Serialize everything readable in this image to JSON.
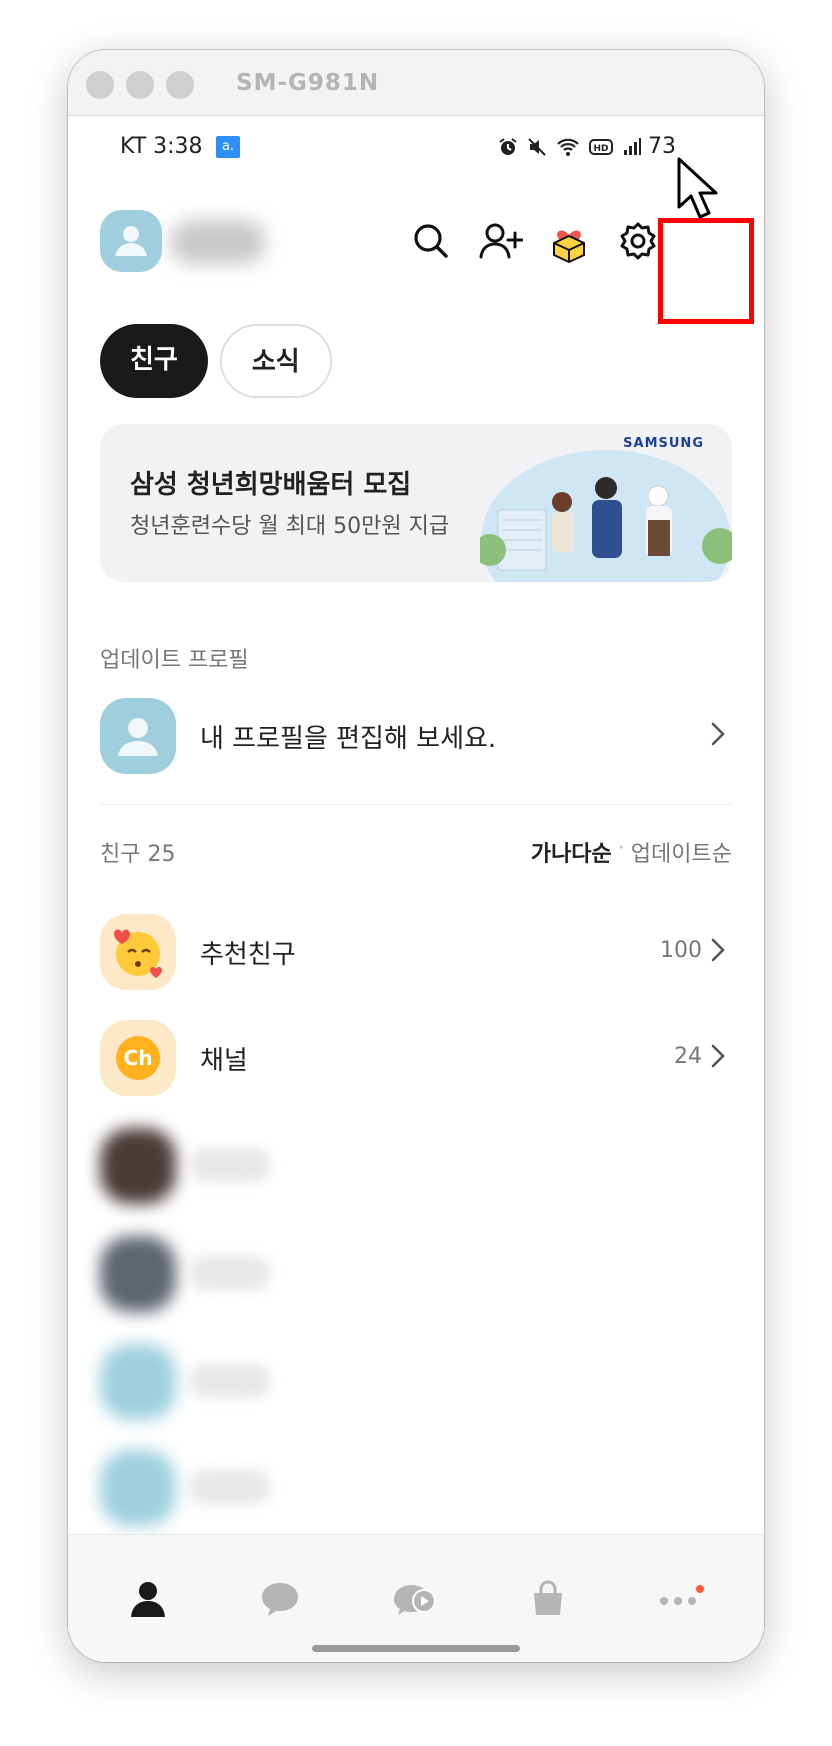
{
  "window": {
    "title": "SM-G981N"
  },
  "statusbar": {
    "carrier_time": "KT 3:38",
    "badge": "a.",
    "battery": "73"
  },
  "tabs": {
    "friends": "친구",
    "news": "소식"
  },
  "banner": {
    "brand": "SAMSUNG",
    "title": "삼성 청년희망배움터 모집",
    "subtitle": "청년훈련수당 월 최대 50만원 지급"
  },
  "update_section": {
    "label": "업데이트 프로필",
    "profile_prompt": "내 프로필을 편집해 보세요."
  },
  "friends_section": {
    "count_label": "친구 25",
    "sort_abc": "가나다순",
    "sort_separator": "·",
    "sort_update": "업데이트순"
  },
  "rows": {
    "recommended": {
      "label": "추천친구",
      "count": "100"
    },
    "channel": {
      "label": "채널",
      "count": "24",
      "icon_text": "Ch"
    }
  },
  "colors": {
    "highlight": "#ff0000",
    "avatar_blue": "#9fcfde",
    "badge_blue": "#2f8ff5",
    "notify_dot": "#ff5a36"
  },
  "icons": [
    "search-icon",
    "add-friend-icon",
    "gift-icon",
    "settings-icon",
    "person-icon",
    "chat-icon",
    "openchat-icon",
    "shopping-icon",
    "more-icon"
  ]
}
